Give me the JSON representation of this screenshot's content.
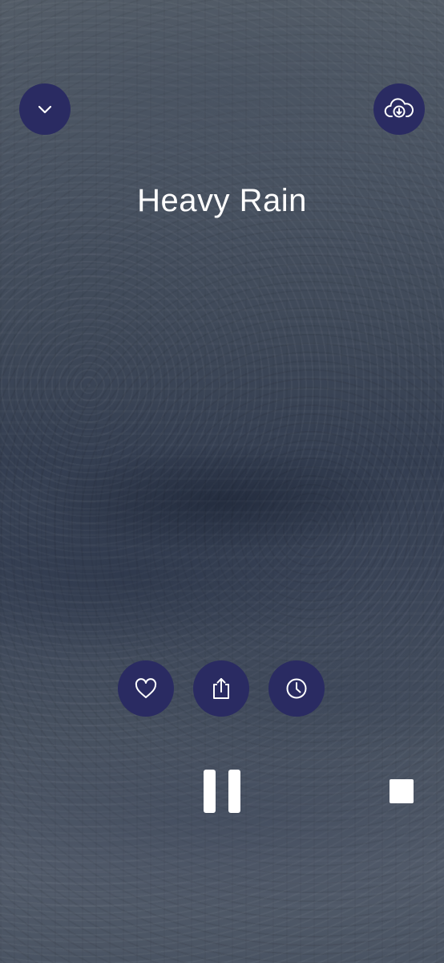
{
  "player": {
    "title": "Heavy Rain"
  },
  "top_bar": {
    "collapse_icon": "chevron-down-icon",
    "download_icon": "cloud-download-icon"
  },
  "actions": {
    "favorite_icon": "heart-icon",
    "share_icon": "share-icon",
    "timer_icon": "clock-icon"
  },
  "controls": {
    "pause_icon": "pause-icon",
    "stop_icon": "stop-icon"
  },
  "colors": {
    "button_bg": "#2a2b62",
    "icon": "#ffffff",
    "background_tint": "#3e4858"
  }
}
